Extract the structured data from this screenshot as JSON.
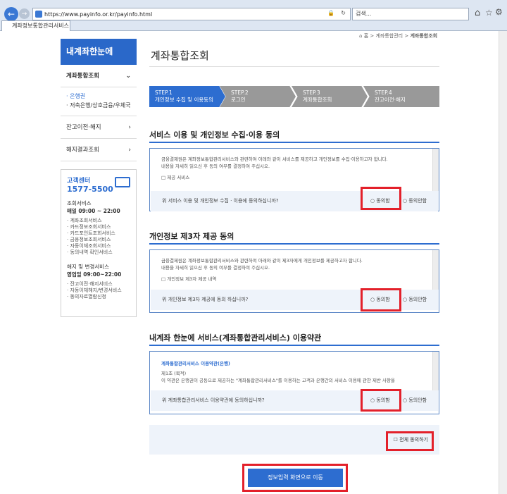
{
  "browser": {
    "url": "https://www.payinfo.or.kr/payinfo.html",
    "search_placeholder": "검색...",
    "tab_title": "계좌정보통합관리서비스"
  },
  "breadcrumb": {
    "home": "홈",
    "level1": "계좌통합관리",
    "level2": "계좌통합조회"
  },
  "sidebar": {
    "title": "내계좌한눈에",
    "menu1": "계좌통합조회",
    "sub1": "· 은행권",
    "sub2": "· 저축은행/상호금융/우체국",
    "menu2": "잔고이전·해지",
    "menu3": "해지결과조회",
    "cs_title": "고객센터",
    "cs_phone": "1577-5500",
    "cs_svc1": "조회서비스",
    "cs_hours1": "매일 09:00 ~ 22:00",
    "cs_items1": [
      "· 계좌조회서비스",
      "· 카드정보조회서비스",
      "· 카드포인트조회서비스",
      "· 금융정보조회서비스",
      "· 자동이체조회서비스",
      "· 동의내역 확인서비스"
    ],
    "cs_svc2": "해지 및 변경서비스",
    "cs_hours2": "영업일 09:00~22:00",
    "cs_items2": [
      "· 잔고이전·해지서비스",
      "· 자동이체해지/변경서비스",
      "· 동의자료열람신청"
    ]
  },
  "main": {
    "title": "계좌통합조회",
    "steps": [
      {
        "num": "STEP.1",
        "label": "개인정보 수집 및 이용동의"
      },
      {
        "num": "STEP.2",
        "label": "로그인"
      },
      {
        "num": "STEP.3",
        "label": "계좌통합조회"
      },
      {
        "num": "STEP.4",
        "label": "잔고이전·해지"
      }
    ],
    "sections": [
      {
        "title": "서비스 이용 및 개인정보 수집·이용 동의",
        "text1": "금융결제원은 계좌정보통합관리서비스와 관련하여 아래와 같이 서비스를 제공하고 개인정보를 수집·이용하고자 합니다.",
        "text2": "내용을 자세히 읽으신 후 동의 여부를 결정하여 주십시오.",
        "text3": "□ 제공 서비스",
        "question": "위 서비스 이용 및 개인정보 수집 · 이용에 동의하십니까?"
      },
      {
        "title": "개인정보 제3자 제공 동의",
        "text1": "금융결제원은 계좌정보통합관리서비스와 관련하여 아래와 같이 제3자에게 개인정보를 제공하고자 합니다.",
        "text2": "내용을 자세히 읽으신 후 동의 여부를 결정하여 주십시오.",
        "text3": "□ 개인정보 제3자 제공 내역",
        "question": "위 개인정보 제3자 제공에 동의 하십니까?"
      },
      {
        "title": "내계좌 한눈에 서비스(계좌통합관리서비스) 이용약관",
        "text1": "계좌통합관리서비스 이용약관(은행)",
        "text2": "제1조 (목적)",
        "text3": "이 약관은 은행권이 공동으로 제공하는 \"계좌통합관리서비스\"를 이용하는 고객과 은행간의 서비스 이용에 관한 제반 사항을",
        "question": "위 계좌통합관리서비스 이용약관에 동의하십니까?"
      }
    ],
    "agree_label": "○ 동의함",
    "disagree_label": "○ 동의안함",
    "all_agree": "☐ 전체 동의하기",
    "submit": "정보입력 화면으로 이동"
  },
  "colors": {
    "accent": "#2d6dd0",
    "highlight": "#e3202a",
    "step_inactive": "#999999"
  }
}
